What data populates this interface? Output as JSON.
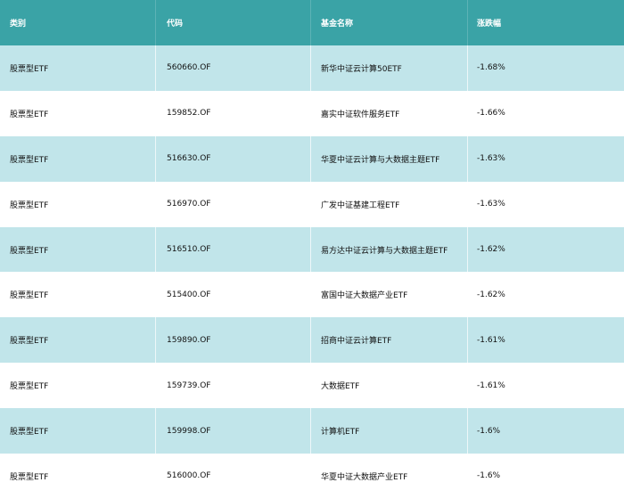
{
  "colors": {
    "header_bg": "#3aa3a6",
    "row_alt_bg": "#c1e5ea",
    "row_bg": "#ffffff"
  },
  "table": {
    "headers": [
      "类别",
      "代码",
      "基金名称",
      "涨跌幅"
    ],
    "rows": [
      [
        "股票型ETF",
        "560660.OF",
        "新华中证云计算50ETF",
        "-1.68%"
      ],
      [
        "股票型ETF",
        "159852.OF",
        "嘉实中证软件服务ETF",
        "-1.66%"
      ],
      [
        "股票型ETF",
        "516630.OF",
        "华夏中证云计算与大数据主题ETF",
        "-1.63%"
      ],
      [
        "股票型ETF",
        "516970.OF",
        "广发中证基建工程ETF",
        "-1.63%"
      ],
      [
        "股票型ETF",
        "516510.OF",
        "易方达中证云计算与大数据主题ETF",
        "-1.62%"
      ],
      [
        "股票型ETF",
        "515400.OF",
        "富国中证大数据产业ETF",
        "-1.62%"
      ],
      [
        "股票型ETF",
        "159890.OF",
        "招商中证云计算ETF",
        "-1.61%"
      ],
      [
        "股票型ETF",
        "159739.OF",
        "大数据ETF",
        "-1.61%"
      ],
      [
        "股票型ETF",
        "159998.OF",
        "计算机ETF",
        "-1.6%"
      ],
      [
        "股票型ETF",
        "516000.OF",
        "华夏中证大数据产业ETF",
        "-1.6%"
      ]
    ]
  }
}
